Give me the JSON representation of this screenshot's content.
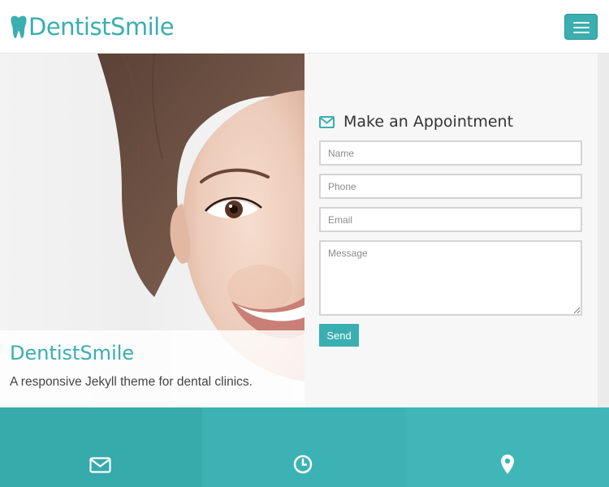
{
  "navbar": {
    "brand_name": "DentistSmile",
    "brand_icon": "tooth-icon",
    "menu_icon": "hamburger-menu-icon"
  },
  "hero": {
    "title": "DentistSmile",
    "subtitle": "A responsive Jekyll theme for dental clinics."
  },
  "appointment": {
    "heading": "Make an Appointment",
    "heading_icon": "envelope-icon",
    "fields": {
      "name_placeholder": "Name",
      "phone_placeholder": "Phone",
      "email_placeholder": "Email",
      "message_placeholder": "Message"
    },
    "send_label": "Send"
  },
  "features": [
    {
      "icon": "envelope-icon"
    },
    {
      "icon": "clock-icon"
    },
    {
      "icon": "map-marker-icon"
    }
  ],
  "colors": {
    "accent": "#3aaeb0",
    "text_dark": "#333333",
    "panel_bg": "#f7f7f7"
  }
}
